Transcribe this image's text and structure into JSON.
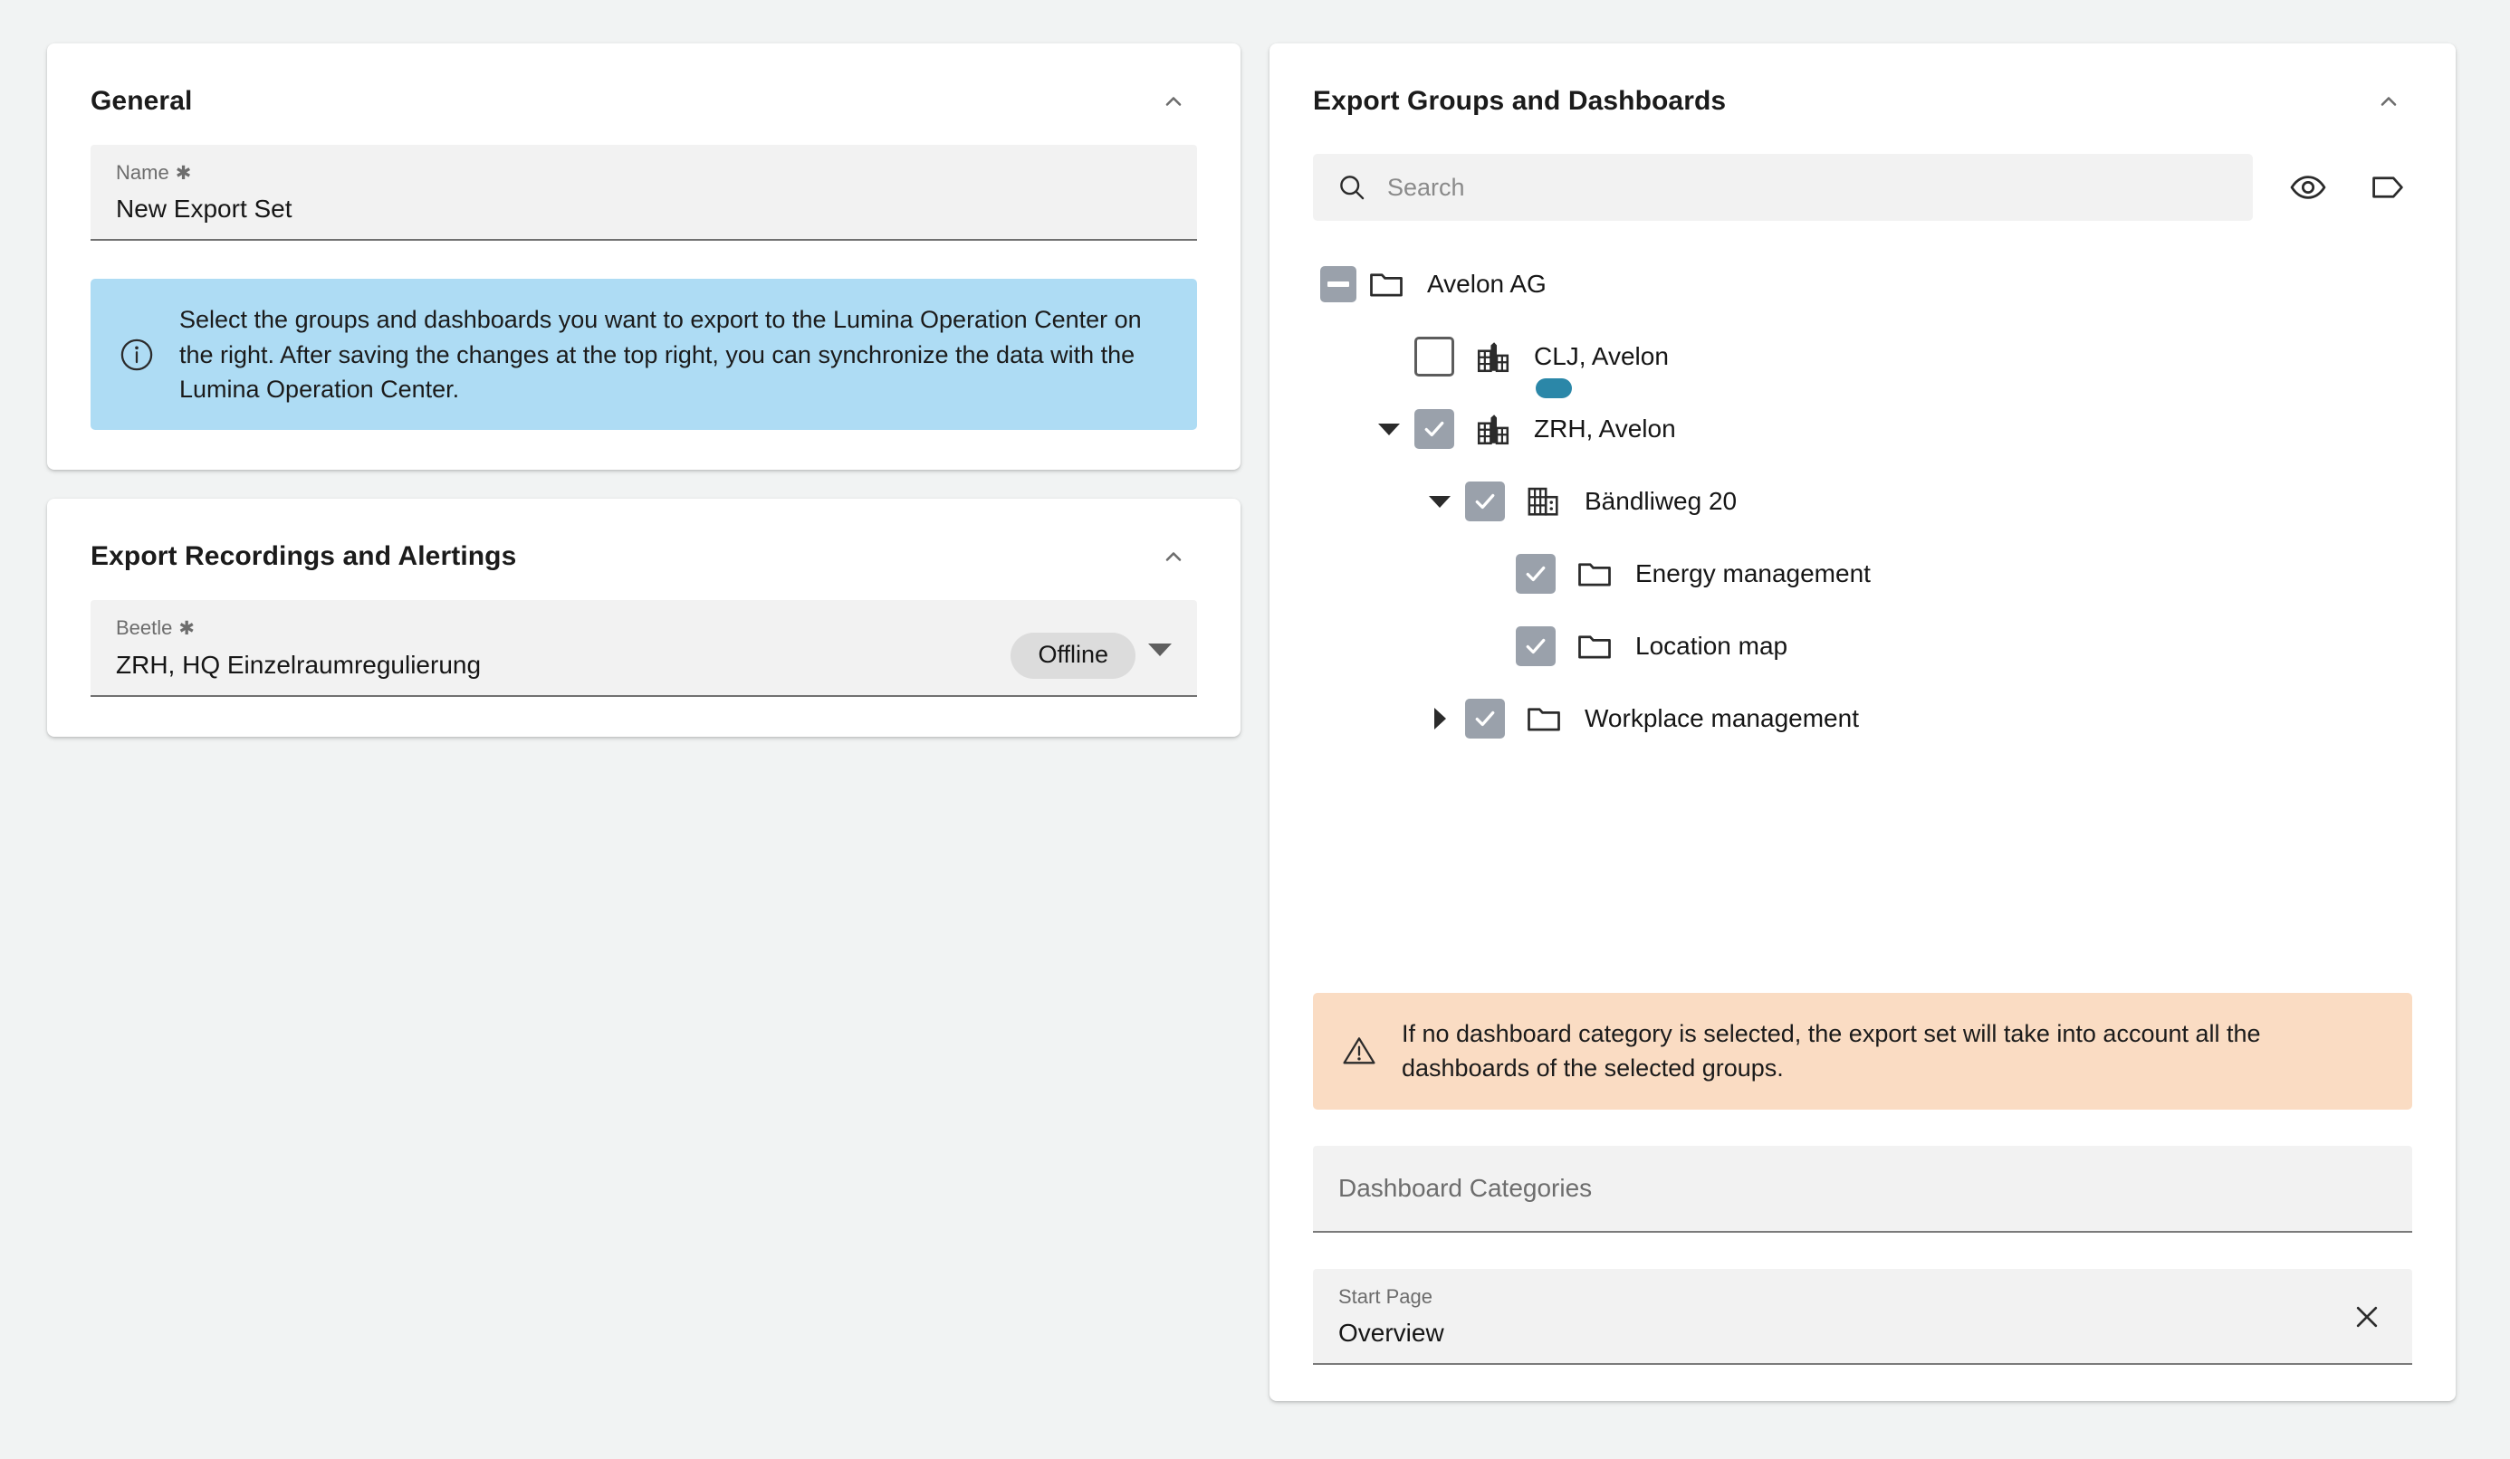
{
  "left": {
    "general": {
      "title": "General",
      "collapse_icon": "chevron-up-icon",
      "name_field": {
        "label": "Name",
        "required_mark": "✱",
        "value": "New Export Set"
      },
      "info_banner": {
        "icon": "info-circle-icon",
        "text": "Select the groups and dashboards you want to export to the Lumina Operation Center on the right. After saving the changes at the top right, you can synchronize the data with the Lumina Operation Center."
      }
    },
    "recordings": {
      "title": "Export Recordings and Alertings",
      "collapse_icon": "chevron-up-icon",
      "beetle_field": {
        "label": "Beetle",
        "required_mark": "✱",
        "value": "ZRH, HQ Einzelraumregulierung",
        "status_chip": "Offline",
        "dropdown_icon": "caret-down-icon"
      }
    }
  },
  "right": {
    "title": "Export Groups and Dashboards",
    "collapse_icon": "chevron-up-icon",
    "search": {
      "icon": "search-icon",
      "placeholder": "Search",
      "value": "",
      "eye_icon": "eye-icon",
      "tag_icon": "tag-icon"
    },
    "tree": [
      {
        "label": "Avelon AG",
        "indent": 0,
        "twisty": "minus-box",
        "checkbox": "indeterminate",
        "icon": "folder-icon",
        "badge": false
      },
      {
        "label": "CLJ, Avelon",
        "indent": 1,
        "twisty": "none",
        "checkbox": "unchecked",
        "icon": "city-icon",
        "badge": true
      },
      {
        "label": "ZRH, Avelon",
        "indent": 1,
        "twisty": "expanded",
        "checkbox": "checked",
        "icon": "city-icon",
        "badge": false
      },
      {
        "label": "Bändliweg 20",
        "indent": 2,
        "twisty": "expanded",
        "checkbox": "checked",
        "icon": "building-icon",
        "badge": false
      },
      {
        "label": "Energy management",
        "indent": 3,
        "twisty": "none",
        "checkbox": "checked",
        "icon": "folder-icon",
        "badge": false
      },
      {
        "label": "Location map",
        "indent": 3,
        "twisty": "none",
        "checkbox": "checked",
        "icon": "folder-icon",
        "badge": false
      },
      {
        "label": "Workplace management",
        "indent": 3,
        "twisty": "collapsed",
        "checkbox": "checked",
        "icon": "folder-icon",
        "badge": false
      }
    ],
    "warn_banner": {
      "icon": "warning-triangle-icon",
      "text": "If no dashboard category is selected, the export set will take into account all the dashboards of the selected groups."
    },
    "dashboard_categories": {
      "placeholder": "Dashboard Categories",
      "value": ""
    },
    "start_page": {
      "label": "Start Page",
      "value": "Overview",
      "clear_icon": "close-icon"
    }
  },
  "colors": {
    "page_bg": "#f1f3f3",
    "card_bg": "#ffffff",
    "field_bg": "#f2f2f2",
    "info_banner": "#aedcf4",
    "warn_banner": "#fadcc3",
    "checkbox_checked": "#9aa1ab",
    "badge": "#2b87a8",
    "chip": "#dcdcdc",
    "text": "#161616",
    "muted_text": "#6d6d6d"
  }
}
